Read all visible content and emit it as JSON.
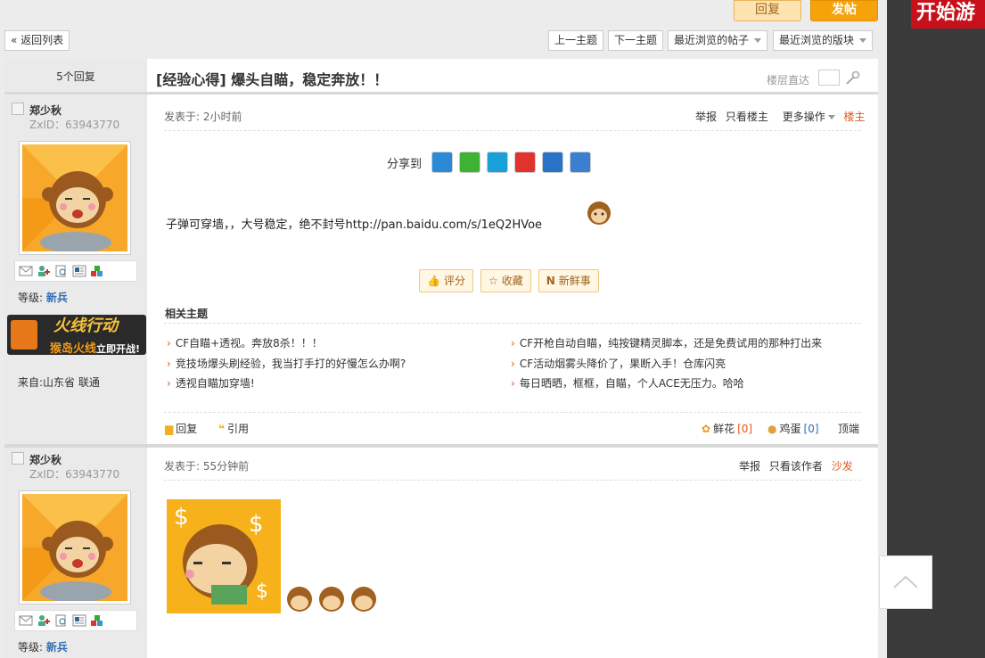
{
  "top_buttons": {
    "reply": "回复",
    "post": "发帖"
  },
  "ad_banner": {
    "text": "开始游"
  },
  "nav": {
    "back": "« 返回列表",
    "prev": "上一主题",
    "next": "下一主题",
    "recent_posts": "最近浏览的帖子",
    "recent_boards": "最近浏览的版块"
  },
  "thread": {
    "reply_count": "5个回复",
    "title": "[经验心得] 爆头自瞄，稳定奔放！！",
    "floor_jump_label": "楼层直达"
  },
  "posts": [
    {
      "username": "郑少秋",
      "zxid": "ZxID：63943770",
      "rank_label": "等级:",
      "rank": "新兵",
      "game_badge": "火线行动",
      "game_badge_sub": "猴岛火线",
      "game_badge_cta": "立即开战!",
      "from": "来自:山东省 联通",
      "posted": "发表于: 2小时前",
      "ops": {
        "report": "举报",
        "only_author": "只看楼主",
        "more": "更多操作",
        "role": "楼主"
      },
      "share_label": "分享到",
      "content": "子弹可穿墙，，大号稳定，绝不封号http://pan.baidu.com/s/1eQ2HVoe",
      "actions": {
        "rate": "评分",
        "fav": "收藏",
        "fresh": "新鲜事"
      },
      "related_title": "相关主题",
      "related": [
        "CF自瞄+透视。奔放8杀！！！",
        "CF开枪自动自瞄，纯按键精灵脚本，还是免费试用的那种打出来",
        "竞技场爆头刷经验，我当打手打的好慢怎么办啊?",
        "CF活动烟雾头降价了，果断入手！仓库闪亮",
        "透视自瞄加穿墙!",
        "每日晒晒，框框，自瞄，个人ACE无压力。哈哈"
      ],
      "footer": {
        "reply": "回复",
        "quote": "引用",
        "flower": "鲜花",
        "flower_count": "0",
        "egg": "鸡蛋",
        "egg_count": "0",
        "top": "顶端"
      }
    },
    {
      "username": "郑少秋",
      "zxid": "ZxID：63943770",
      "rank_label": "等级:",
      "rank": "新兵",
      "posted": "发表于: 55分钟前",
      "ops": {
        "report": "举报",
        "only_author": "只看该作者",
        "role": "沙发"
      }
    }
  ],
  "colors": {
    "accent_orange": "#e2581e",
    "post_button": "#f6a30b",
    "rank_blue": "#2f6fb6"
  }
}
